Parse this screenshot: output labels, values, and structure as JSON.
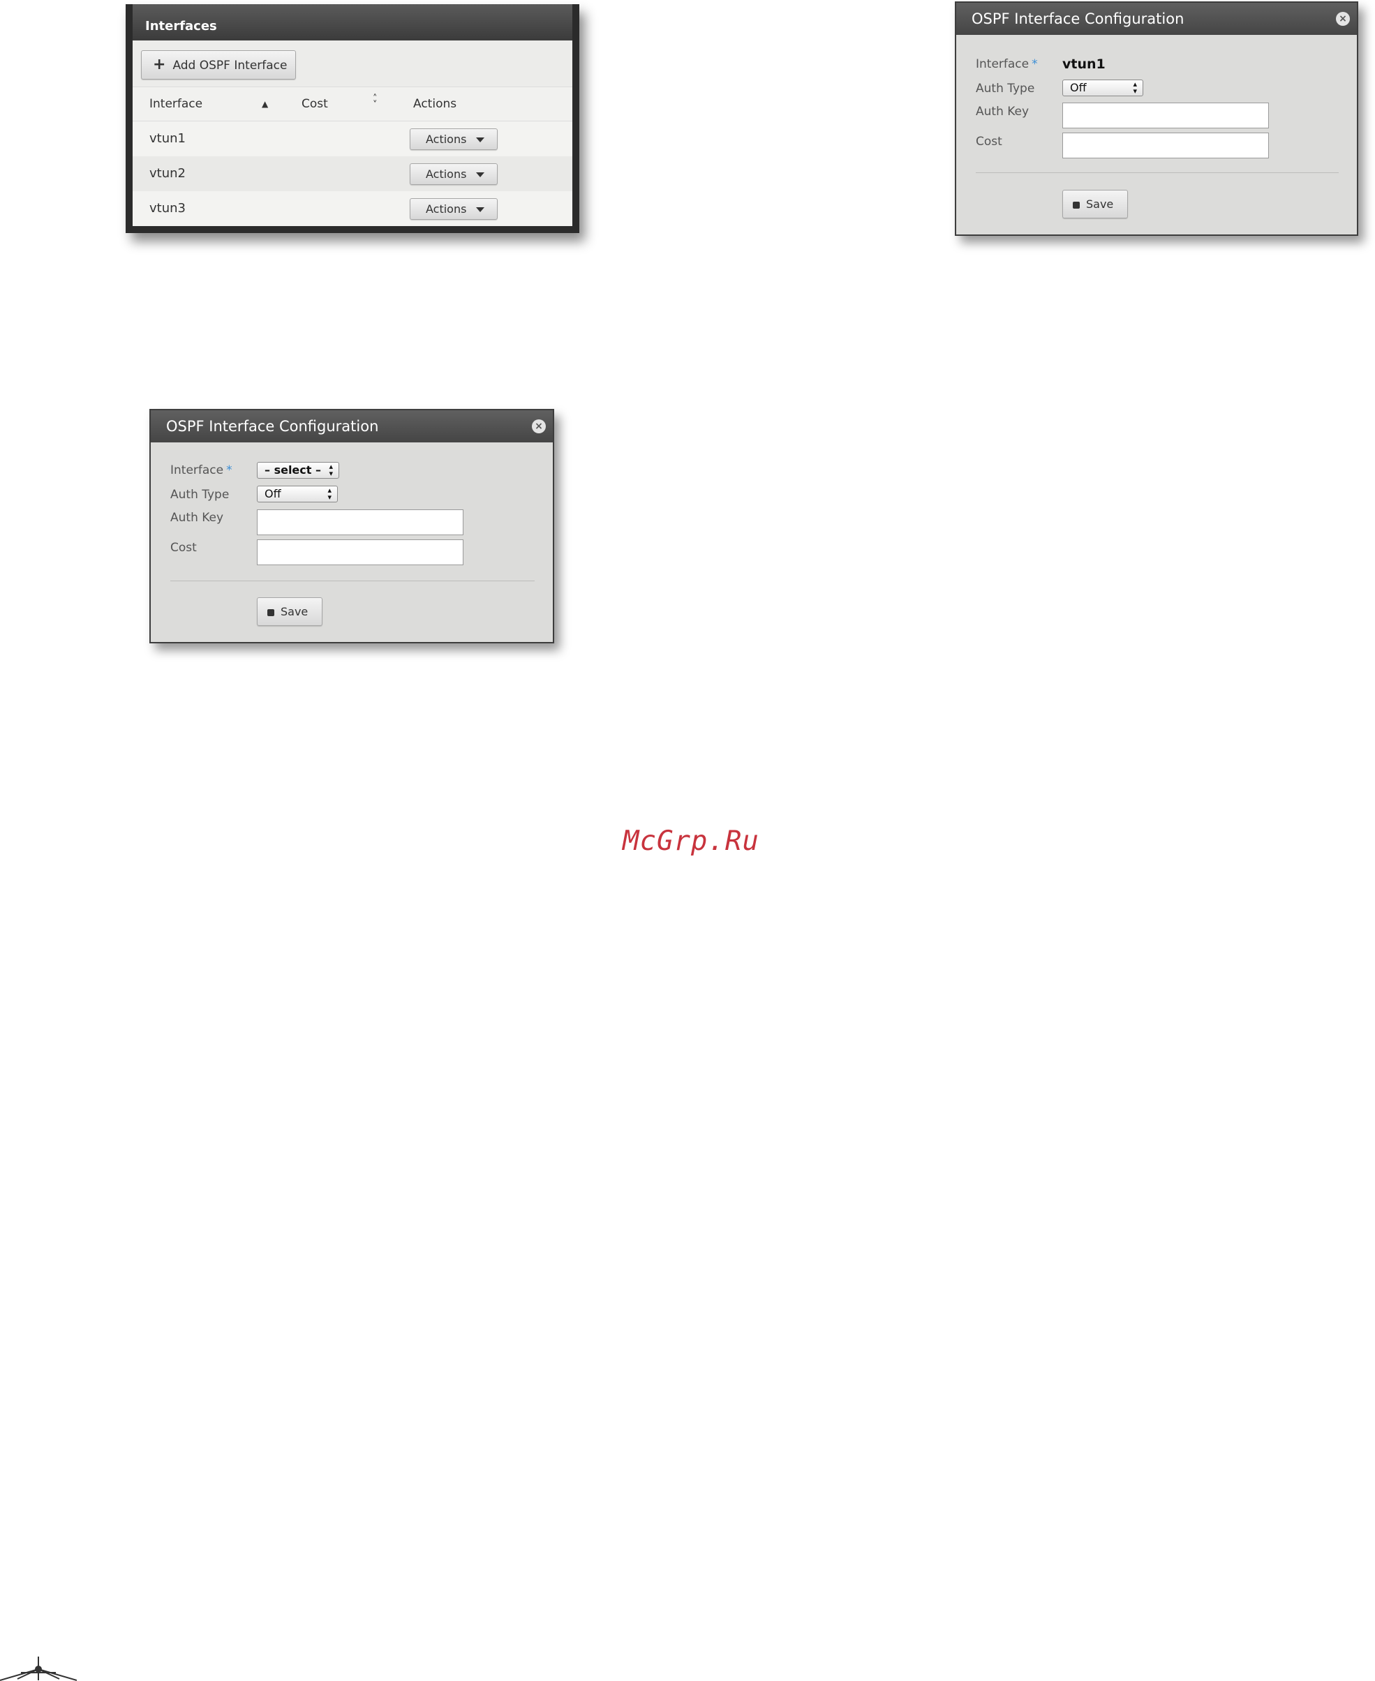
{
  "interfaces_panel": {
    "title": "Interfaces",
    "add_button": "Add OSPF Interface",
    "columns": [
      "Interface",
      "Cost",
      "Actions"
    ],
    "rows": [
      {
        "interface": "vtun1",
        "cost": "",
        "action": "Actions"
      },
      {
        "interface": "vtun2",
        "cost": "",
        "action": "Actions"
      },
      {
        "interface": "vtun3",
        "cost": "",
        "action": "Actions"
      }
    ]
  },
  "dialog_edit": {
    "title": "OSPF Interface Configuration",
    "interface_label": "Interface",
    "required_mark": "*",
    "interface_value": "vtun1",
    "auth_type_label": "Auth Type",
    "auth_type_value": "Off",
    "auth_key_label": "Auth Key",
    "auth_key_value": "",
    "cost_label": "Cost",
    "cost_value": "",
    "save_label": "Save"
  },
  "dialog_new": {
    "title": "OSPF Interface Configuration",
    "interface_label": "Interface",
    "required_mark": "*",
    "interface_select": "– select –",
    "auth_type_label": "Auth Type",
    "auth_type_value": "Off",
    "auth_key_label": "Auth Key",
    "auth_key_value": "",
    "cost_label": "Cost",
    "cost_value": "",
    "save_label": "Save"
  },
  "watermark": "McGrp.Ru",
  "icons": [
    "plus-icon",
    "sort-asc-icon",
    "sort-icon",
    "caret-down-icon",
    "close-icon",
    "select-arrows-icon",
    "save-disk-icon",
    "logo-icon"
  ]
}
